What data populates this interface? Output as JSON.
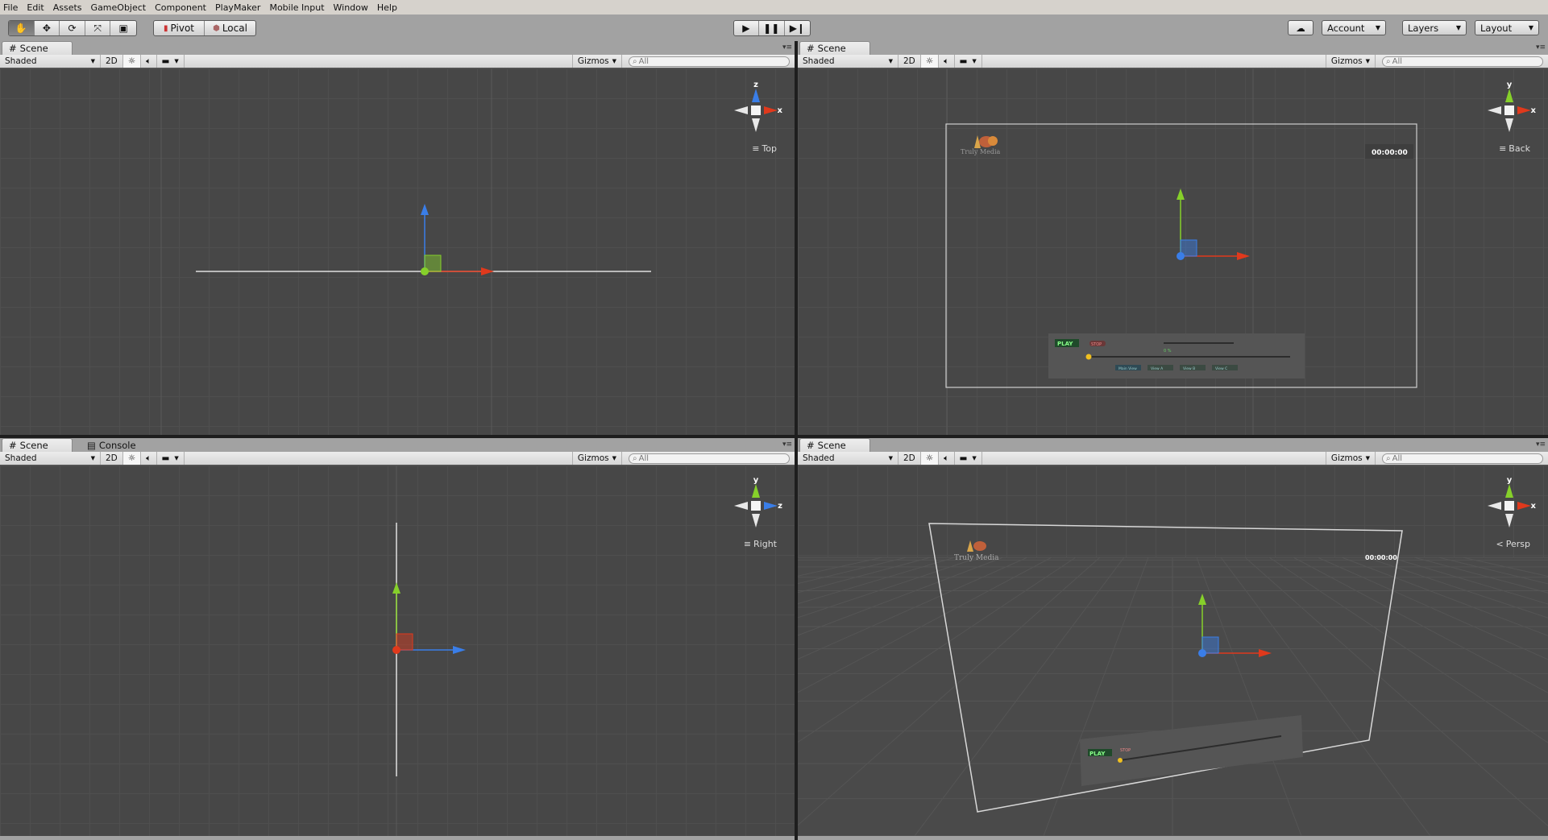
{
  "menu": [
    "File",
    "Edit",
    "Assets",
    "GameObject",
    "Component",
    "PlayMaker",
    "Mobile Input",
    "Window",
    "Help"
  ],
  "toolbar": {
    "tools": [
      "hand-tool",
      "move-tool",
      "rotate-tool",
      "scale-tool",
      "rect-tool"
    ],
    "pivot": "Pivot",
    "local": "Local",
    "account": "Account",
    "layers": "Layers",
    "layout": "Layout"
  },
  "scene_toolbar": {
    "tab": "Scene",
    "console_tab": "Console",
    "shading": "Shaded",
    "mode_2d": "2D",
    "gizmos": "Gizmos",
    "search_placeholder": "All"
  },
  "views": {
    "top": {
      "label": "Top",
      "up_axis": "z",
      "right_axis": "x"
    },
    "back": {
      "label": "Back",
      "up_axis": "y",
      "right_axis": "x"
    },
    "right": {
      "label": "Right",
      "up_axis": "y",
      "right_axis": "z"
    },
    "persp": {
      "label": "Persp",
      "up_axis": "y",
      "right_axis": "x"
    }
  },
  "scene_ui": {
    "logo": "Truly Media",
    "timer": "00:00:00",
    "play": "PLAY",
    "stop": "STOP",
    "view_buttons": [
      "Main View",
      "View A",
      "View B",
      "View C"
    ],
    "percent": "0 %"
  },
  "colors": {
    "x_axis": "#e0391c",
    "y_axis": "#86d02a",
    "z_axis": "#3a7ee8",
    "viewport_bg": "#474747",
    "toolbar_bg": "#a2a2a2"
  }
}
